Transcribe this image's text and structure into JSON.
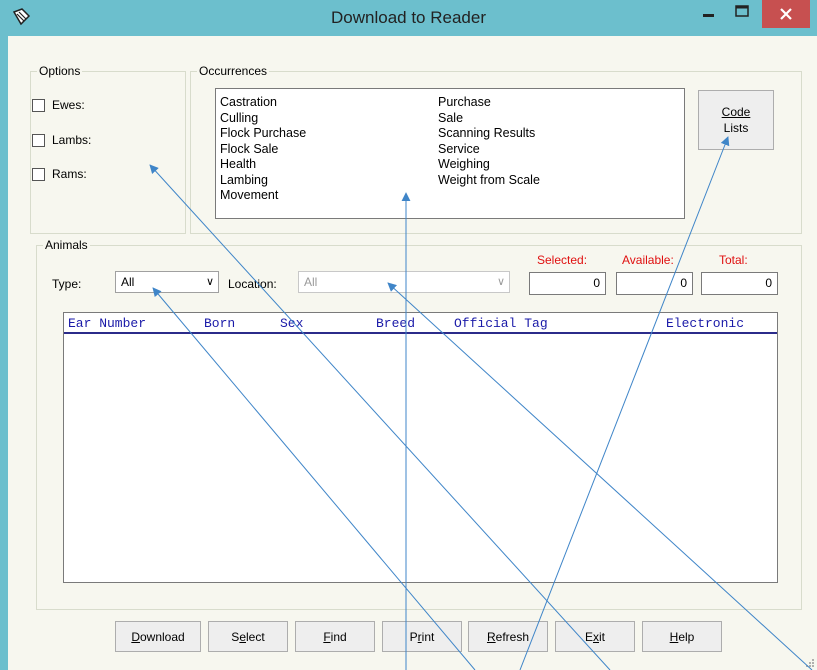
{
  "window": {
    "title": "Download to Reader",
    "titlebar_color": "#6cbfcd",
    "close_color": "#c75050"
  },
  "options": {
    "legend": "Options",
    "items": [
      {
        "label": "Ewes:",
        "checked": false
      },
      {
        "label": "Lambs:",
        "checked": false
      },
      {
        "label": "Rams:",
        "checked": false
      }
    ]
  },
  "occurrences": {
    "legend": "Occurrences",
    "col1": [
      "Castration",
      "Culling",
      "Flock Purchase",
      "Flock Sale",
      "Health",
      "Lambing",
      "Movement"
    ],
    "col2": [
      "Purchase",
      "Sale",
      "Scanning Results",
      "Service",
      "Weighing",
      "Weight from Scale"
    ],
    "code_lists_line1": "Code",
    "code_lists_line2": "Lists"
  },
  "animals": {
    "legend": "Animals",
    "type_label": "Type:",
    "type_value": "All",
    "location_label": "Location:",
    "location_value": "All",
    "selected_label": "Selected:",
    "available_label": "Available:",
    "total_label": "Total:",
    "selected_value": "0",
    "available_value": "0",
    "total_value": "0",
    "columns": [
      "Ear Number",
      "Born",
      "Sex",
      "Breed",
      "Official Tag",
      "Electronic"
    ],
    "header_color": "#1a1aa8",
    "counter_label_color": "#e01010"
  },
  "buttons": {
    "download": "Download",
    "select": "Select",
    "find": "Find",
    "print": "Print",
    "refresh": "Refresh",
    "exit": "Exit",
    "help": "Help"
  },
  "annotation_color": "#3f85c8"
}
